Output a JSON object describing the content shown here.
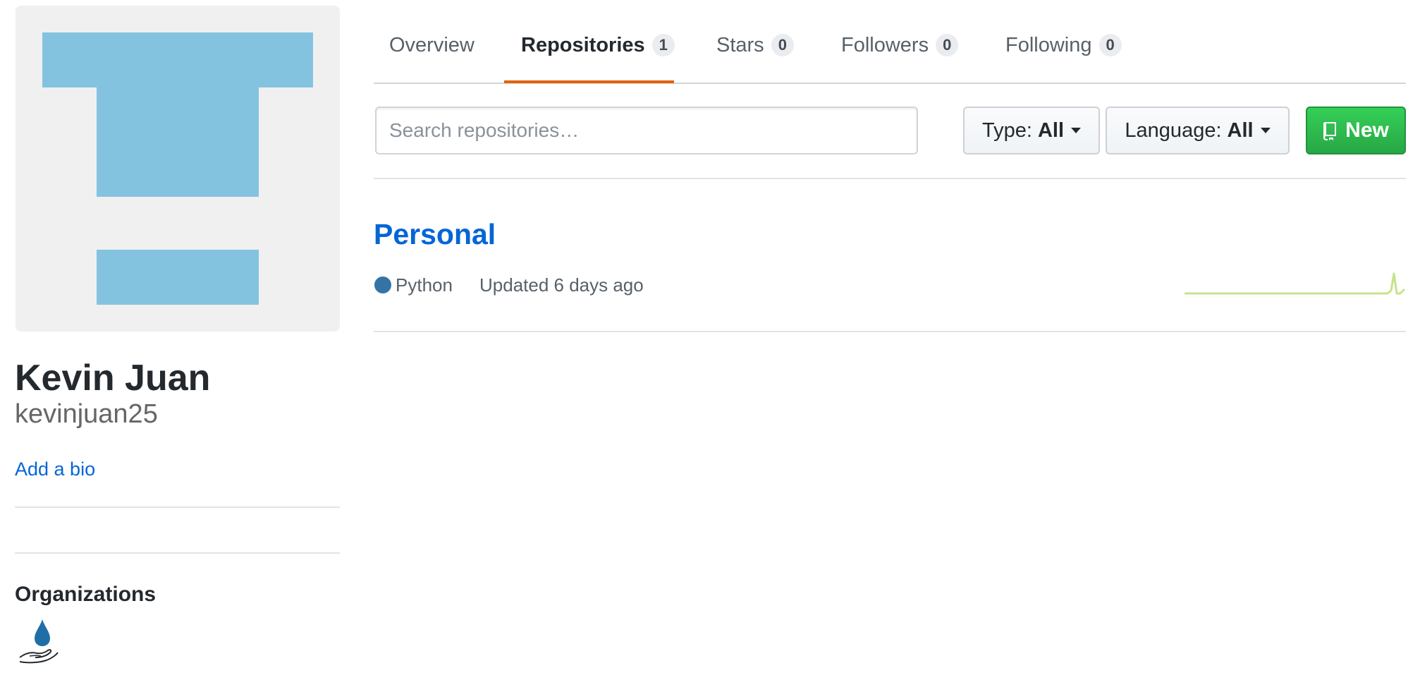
{
  "profile": {
    "full_name": "Kevin Juan",
    "username": "kevinjuan25",
    "add_bio": "Add a bio",
    "avatar_color": "#84c3df"
  },
  "organizations": {
    "heading": "Organizations"
  },
  "tabs": [
    {
      "label": "Overview",
      "count": null,
      "selected": false
    },
    {
      "label": "Repositories",
      "count": "1",
      "selected": true
    },
    {
      "label": "Stars",
      "count": "0",
      "selected": false
    },
    {
      "label": "Followers",
      "count": "0",
      "selected": false
    },
    {
      "label": "Following",
      "count": "0",
      "selected": false
    }
  ],
  "filters": {
    "search_placeholder": "Search repositories…",
    "type_label": "Type:",
    "type_value": "All",
    "language_label": "Language:",
    "language_value": "All",
    "new_button": "New"
  },
  "repos": [
    {
      "name": "Personal",
      "language": "Python",
      "language_color": "#3572A5",
      "updated": "Updated 6 days ago"
    }
  ],
  "colors": {
    "link": "#0366d6",
    "tab_accent": "#e36209",
    "new_button": "#28a745",
    "sparkline": "#c6e48b"
  }
}
